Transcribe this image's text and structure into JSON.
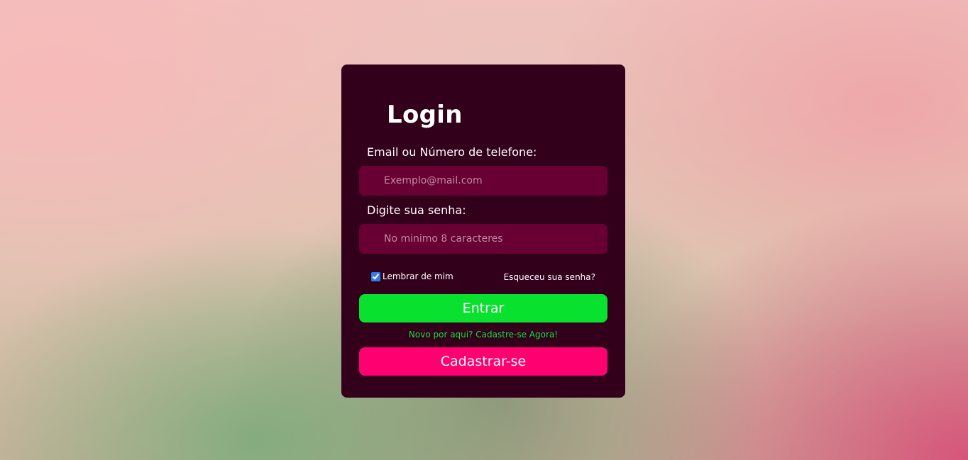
{
  "login": {
    "title": "Login",
    "email_label": "Email ou Número de telefone:",
    "email_placeholder": "Exemplo@mail.com",
    "email_value": "",
    "password_label": "Digite sua senha:",
    "password_placeholder": "No minimo 8 caracteres",
    "password_value": "",
    "remember_label": "Lembrar de mim",
    "remember_checked": true,
    "forgot_link": "Esqueceu sua senha?",
    "enter_button": "Entrar",
    "signup_prompt": "Novo por aqui? Cadastre-se Agora!",
    "register_button": "Cadastrar-se"
  },
  "colors": {
    "card_background": "#33001c",
    "input_background": "#690033",
    "enter_button": "#08e22f",
    "register_button": "#ff0070",
    "signup_link": "#0de13a"
  }
}
